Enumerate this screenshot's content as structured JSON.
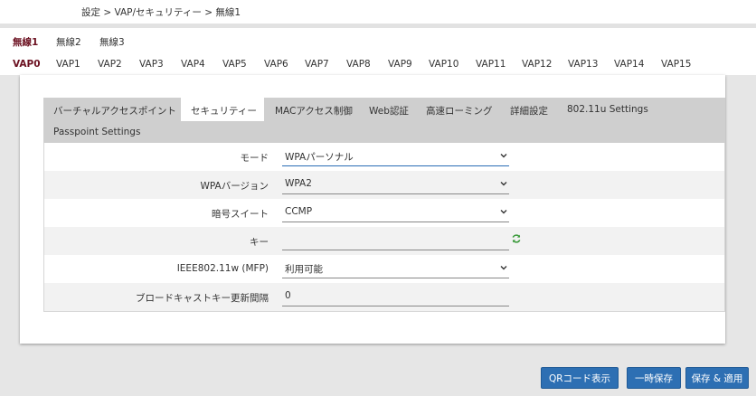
{
  "breadcrumb": "設定 > VAP/セキュリティー > 無線1",
  "radio_tabs": [
    {
      "label": "無線1",
      "active": true
    },
    {
      "label": "無線2",
      "active": false
    },
    {
      "label": "無線3",
      "active": false
    }
  ],
  "vap_tabs": [
    {
      "label": "VAP0",
      "active": true
    },
    {
      "label": "VAP1"
    },
    {
      "label": "VAP2"
    },
    {
      "label": "VAP3"
    },
    {
      "label": "VAP4"
    },
    {
      "label": "VAP5"
    },
    {
      "label": "VAP6"
    },
    {
      "label": "VAP7"
    },
    {
      "label": "VAP8"
    },
    {
      "label": "VAP9"
    },
    {
      "label": "VAP10"
    },
    {
      "label": "VAP11"
    },
    {
      "label": "VAP12"
    },
    {
      "label": "VAP13"
    },
    {
      "label": "VAP14"
    },
    {
      "label": "VAP15"
    }
  ],
  "sub_tabs": [
    {
      "label": "バーチャルアクセスポイント"
    },
    {
      "label": "セキュリティー",
      "active": true
    },
    {
      "label": "MACアクセス制御"
    },
    {
      "label": "Web認証"
    },
    {
      "label": "高速ローミング"
    },
    {
      "label": "詳細設定"
    },
    {
      "label": "802.11u Settings"
    },
    {
      "label": "Passpoint Settings"
    }
  ],
  "form": {
    "mode": {
      "label": "モード",
      "value": "WPAパーソナル"
    },
    "wpa_version": {
      "label": "WPAバージョン",
      "value": "WPA2"
    },
    "cipher_suite": {
      "label": "暗号スイート",
      "value": "CCMP"
    },
    "key": {
      "label": "キー",
      "value": ""
    },
    "mfp": {
      "label": "IEEE802.11w (MFP)",
      "value": "利用可能"
    },
    "broadcast_key_interval": {
      "label": "ブロードキャストキー更新間隔",
      "value": "0"
    }
  },
  "buttons": {
    "qr": "QRコード表示",
    "temp_save": "一時保存",
    "save_apply": "保存 & 適用"
  },
  "colors": {
    "accent": "#6b1020",
    "button": "#2d6fb3",
    "refresh_icon": "#3a9a3a"
  },
  "icons": {
    "dropdown": "chevron-down-icon",
    "refresh": "refresh-icon"
  }
}
